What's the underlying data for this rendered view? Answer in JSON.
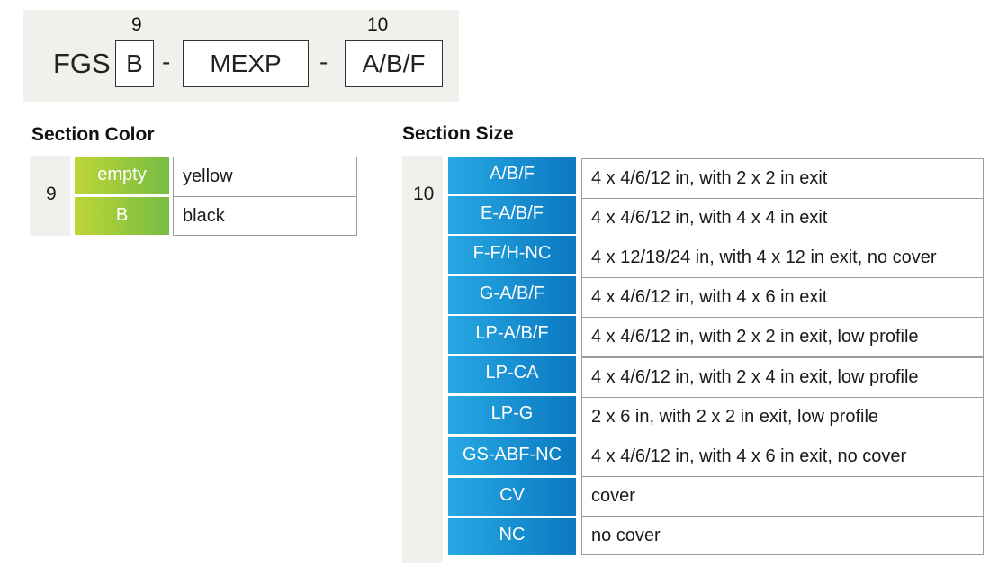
{
  "part_number": {
    "prefix": "FGS",
    "field_9": "B",
    "dash_1": "-",
    "middle": "MEXP",
    "dash_2": "-",
    "field_10": "A/B/F",
    "num_9": "9",
    "num_10": "10"
  },
  "section_color": {
    "title": "Section Color",
    "group_num": "9",
    "rows": [
      {
        "code": "empty",
        "desc": "yellow"
      },
      {
        "code": "B",
        "desc": "black"
      }
    ]
  },
  "section_size": {
    "title": "Section Size",
    "group_num": "10",
    "rows": [
      {
        "code": "A/B/F",
        "desc": "4 x 4/6/12 in, with 2 x 2 in exit"
      },
      {
        "code": "E-A/B/F",
        "desc": "4 x 4/6/12 in, with 4 x 4 in exit"
      },
      {
        "code": "F-F/H-NC",
        "desc": "4 x 12/18/24 in, with 4 x 12 in exit, no cover"
      },
      {
        "code": "G-A/B/F",
        "desc": "4 x 4/6/12 in, with 4 x 6 in exit"
      },
      {
        "code": "LP-A/B/F",
        "desc": "4 x 4/6/12 in, with 2 x 2 in exit, low profile"
      },
      {
        "code": "LP-CA",
        "desc": "4 x 4/6/12 in, with 2 x 4 in exit, low profile"
      },
      {
        "code": "LP-G",
        "desc": "2 x 6 in, with 2 x 2 in exit, low profile"
      },
      {
        "code": "GS-ABF-NC",
        "desc": "4 x 4/6/12 in, with 4 x 6 in exit, no cover"
      },
      {
        "code": "CV",
        "desc": "cover"
      },
      {
        "code": "NC",
        "desc": "no cover"
      }
    ]
  },
  "colors": {
    "group_bg": "#f1f0ec",
    "green_start": "#bdd637",
    "green_end": "#76bc43",
    "blue_start": "#27a9e4",
    "blue_end": "#0b78c0"
  }
}
